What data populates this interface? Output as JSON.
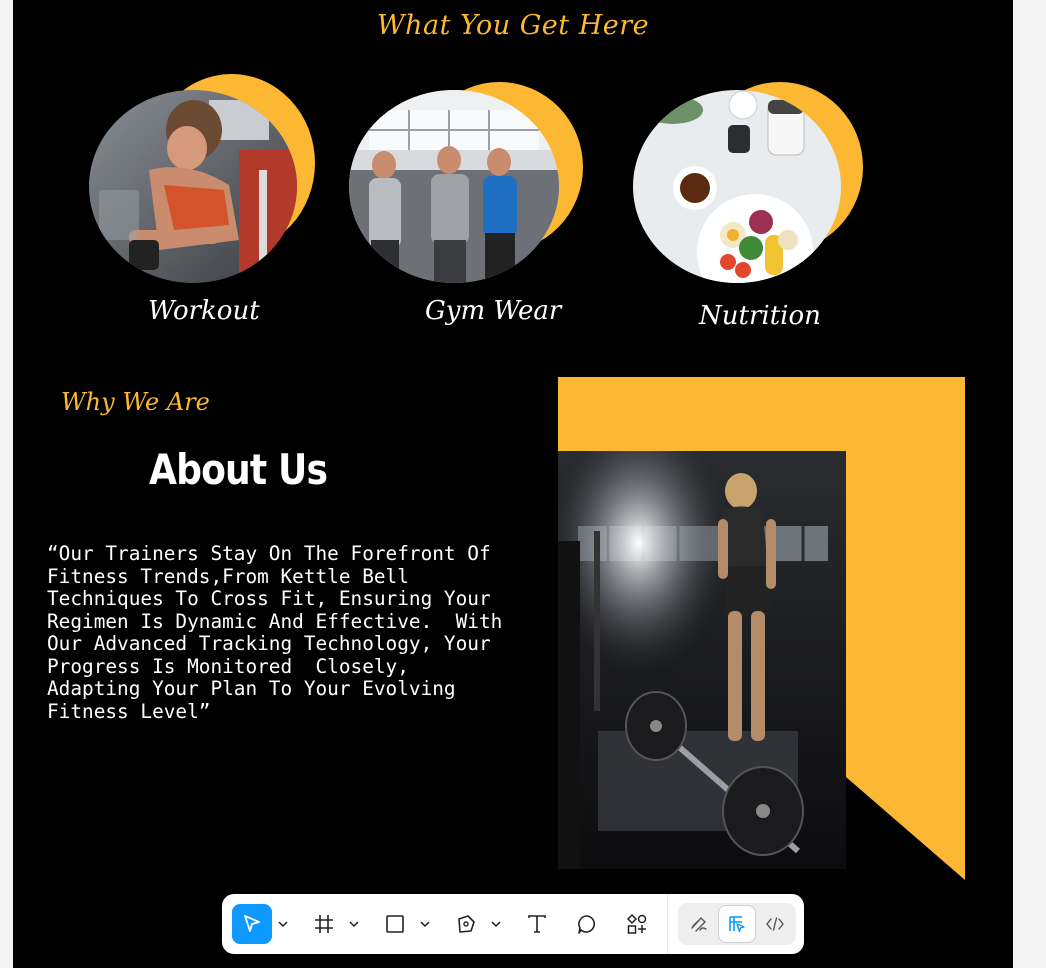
{
  "section_services": {
    "heading": "What You Get Here",
    "cards": [
      {
        "label": "Workout",
        "image": "woman lifting dumbbell in gym"
      },
      {
        "label": "Gym Wear",
        "image": "three men walking in gym wearing sportswear"
      },
      {
        "label": "Nutrition",
        "image": "healthy meal bowl with supplements"
      }
    ]
  },
  "section_about": {
    "eyebrow": "Why We Are",
    "title": "About Us",
    "quote": "“Our Trainers Stay On The Forefront Of\nFitness Trends,From Kettle Bell\nTechniques To Cross Fit, Ensuring Your\nRegimen Is Dynamic And Effective.  With\nOur Advanced Tracking Technology, Your\nProgress Is Monitored  Closely,\nAdapting Your Plan To Your Evolving\nFitness Level”",
    "image": "woman with chalk next to barbell in dark gym"
  },
  "colors": {
    "accent": "#FDB833",
    "background": "#000000",
    "toolbar_active": "#0D99FF"
  },
  "toolbar": {
    "tools": [
      {
        "name": "move-tool",
        "icon": "cursor-arrow-icon",
        "active": true
      },
      {
        "name": "frame-tool",
        "icon": "hash-frame-icon"
      },
      {
        "name": "shape-tool",
        "icon": "rectangle-icon"
      },
      {
        "name": "pen-tool",
        "icon": "pen-nib-icon"
      },
      {
        "name": "text-tool",
        "icon": "text-t-icon"
      },
      {
        "name": "comment-tool",
        "icon": "speech-bubble-icon"
      },
      {
        "name": "actions-tool",
        "icon": "components-plus-icon"
      }
    ],
    "modes": [
      {
        "name": "draw-mode",
        "icon": "scribble-icon"
      },
      {
        "name": "design-mode",
        "icon": "layout-cursor-icon",
        "selected": true
      },
      {
        "name": "dev-mode",
        "icon": "code-brackets-icon"
      }
    ]
  }
}
